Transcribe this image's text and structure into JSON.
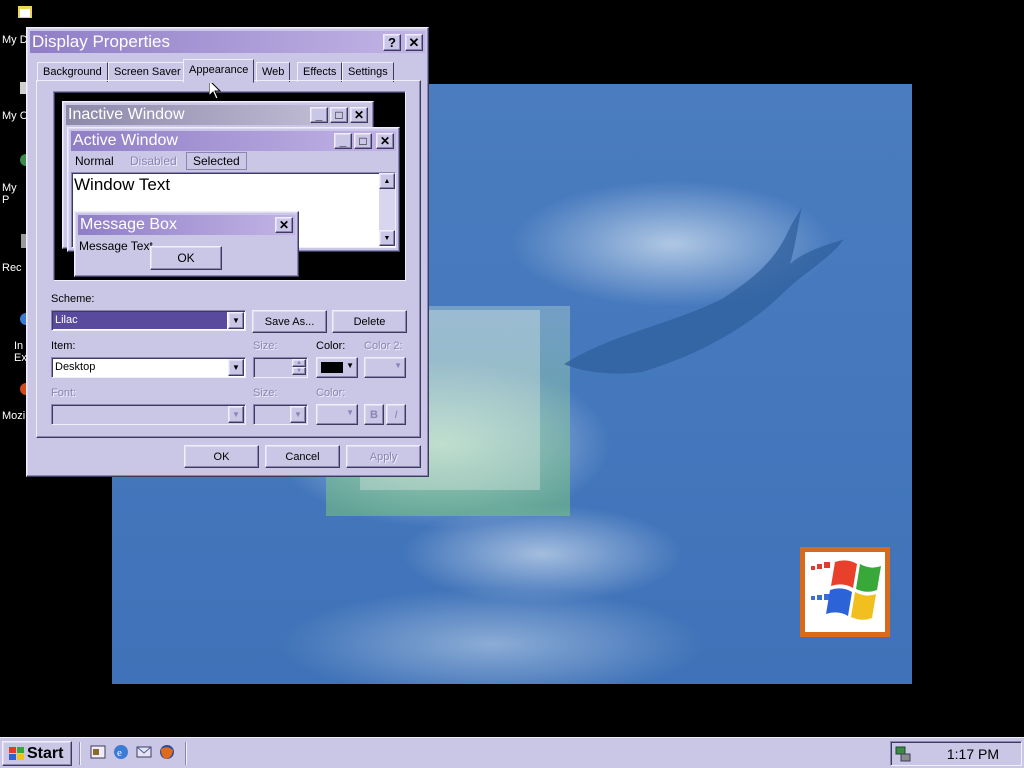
{
  "desktop": {
    "icons": [
      {
        "label": "My D",
        "icon": "my-documents-icon"
      },
      {
        "label": "My C",
        "icon": "my-computer-icon"
      },
      {
        "label": "My\nP",
        "icon": "network-places-icon"
      },
      {
        "label": "Rec",
        "icon": "recycle-bin-icon"
      },
      {
        "label": "In\nEx",
        "icon": "internet-explorer-icon"
      },
      {
        "label": "Mozil",
        "icon": "mozilla-icon"
      }
    ]
  },
  "dialog": {
    "title": "Display Properties",
    "help_glyph": "?",
    "close_glyph": "✕",
    "tabs": [
      "Background",
      "Screen Saver",
      "Appearance",
      "Web",
      "Effects",
      "Settings"
    ],
    "active_tab": "Appearance",
    "preview": {
      "inactive_title": "Inactive Window",
      "active_title": "Active Window",
      "menu": {
        "normal": "Normal",
        "disabled": "Disabled",
        "selected": "Selected"
      },
      "window_text": "Window Text",
      "message_box_title": "Message Box",
      "message_text": "Message Text",
      "ok": "OK"
    },
    "scheme": {
      "label": "Scheme:",
      "value": "Lilac",
      "save_as": "Save As...",
      "delete": "Delete"
    },
    "item": {
      "label": "Item:",
      "value": "Desktop",
      "size_label": "Size:",
      "color_label": "Color:",
      "color2_label": "Color 2:"
    },
    "font": {
      "label": "Font:",
      "size_label": "Size:",
      "color_label": "Color:",
      "bold": "B",
      "italic": "I"
    },
    "buttons": {
      "ok": "OK",
      "cancel": "Cancel",
      "apply": "Apply"
    }
  },
  "taskbar": {
    "start_label": "Start",
    "quick_launch": [
      "show-desktop-icon",
      "internet-explorer-icon",
      "outlook-icon",
      "firefox-icon"
    ],
    "clock": "1:17 PM"
  },
  "colors": {
    "theme_face": "#cac6e6",
    "title_active_start": "#8f7ec6",
    "title_active_end": "#c2b4e6",
    "title_inactive_start": "#8c88a8",
    "title_inactive_end": "#c8c4dc",
    "selection": "#5a4a9e",
    "wallpaper_blue": "#4578bd"
  }
}
